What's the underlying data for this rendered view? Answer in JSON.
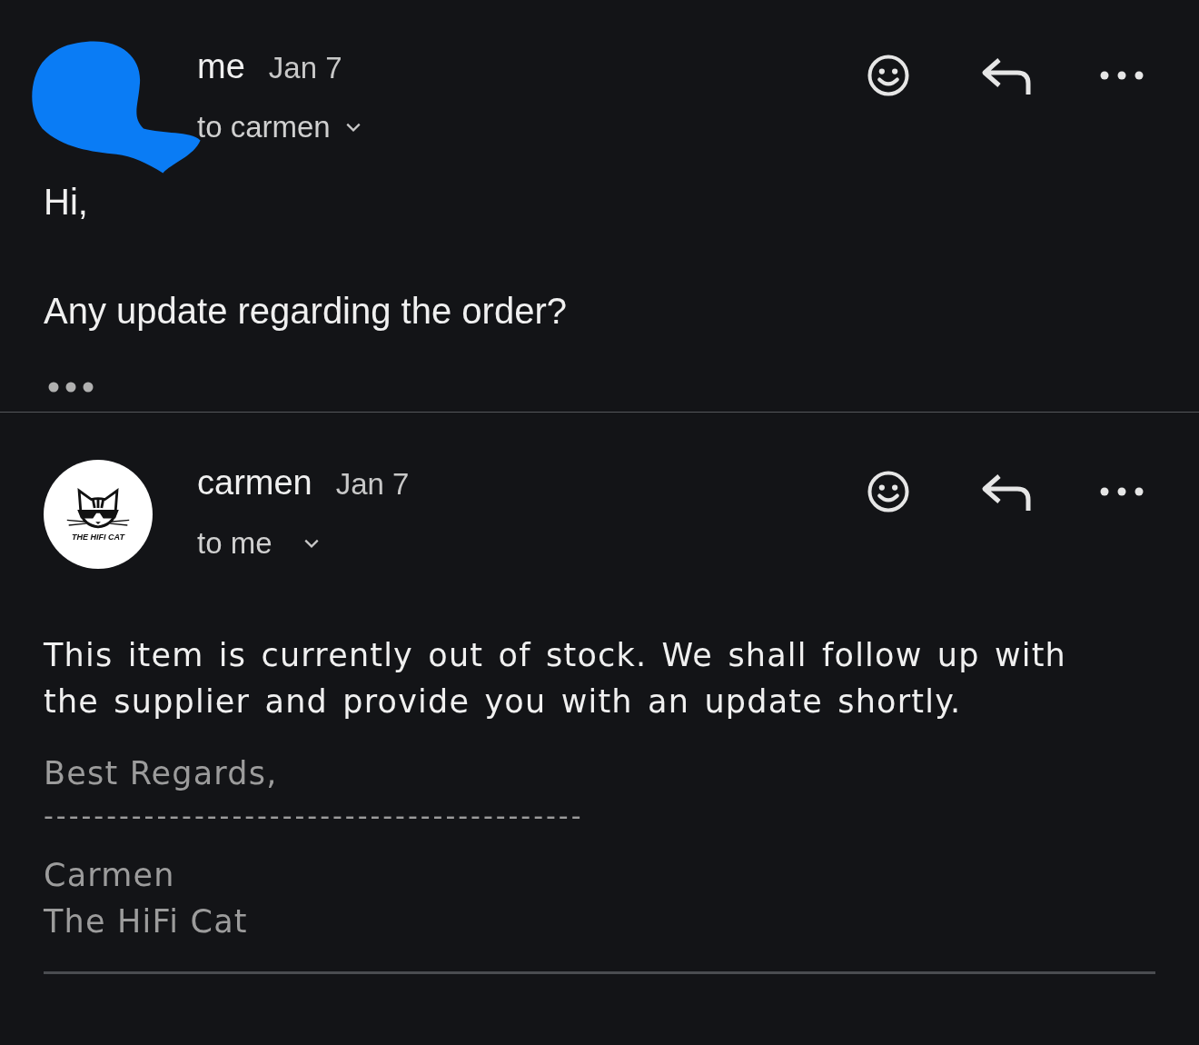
{
  "messages": [
    {
      "sender": "me",
      "date": "Jan 7",
      "recipient": "to carmen",
      "avatar": {
        "kind": "redacted"
      },
      "body": [
        "Hi,",
        "Any update regarding the order?"
      ]
    },
    {
      "sender": "carmen",
      "date": "Jan 7",
      "recipient": "to me",
      "avatar": {
        "kind": "logo",
        "text": "THE HIFI CAT"
      },
      "body": [
        "This item is currently out of stock. We shall follow up with the supplier and provide you with an update shortly."
      ],
      "signature": [
        "Best Regards,",
        "-------------------------------------------",
        "Carmen",
        "The HiFi Cat"
      ]
    }
  ]
}
